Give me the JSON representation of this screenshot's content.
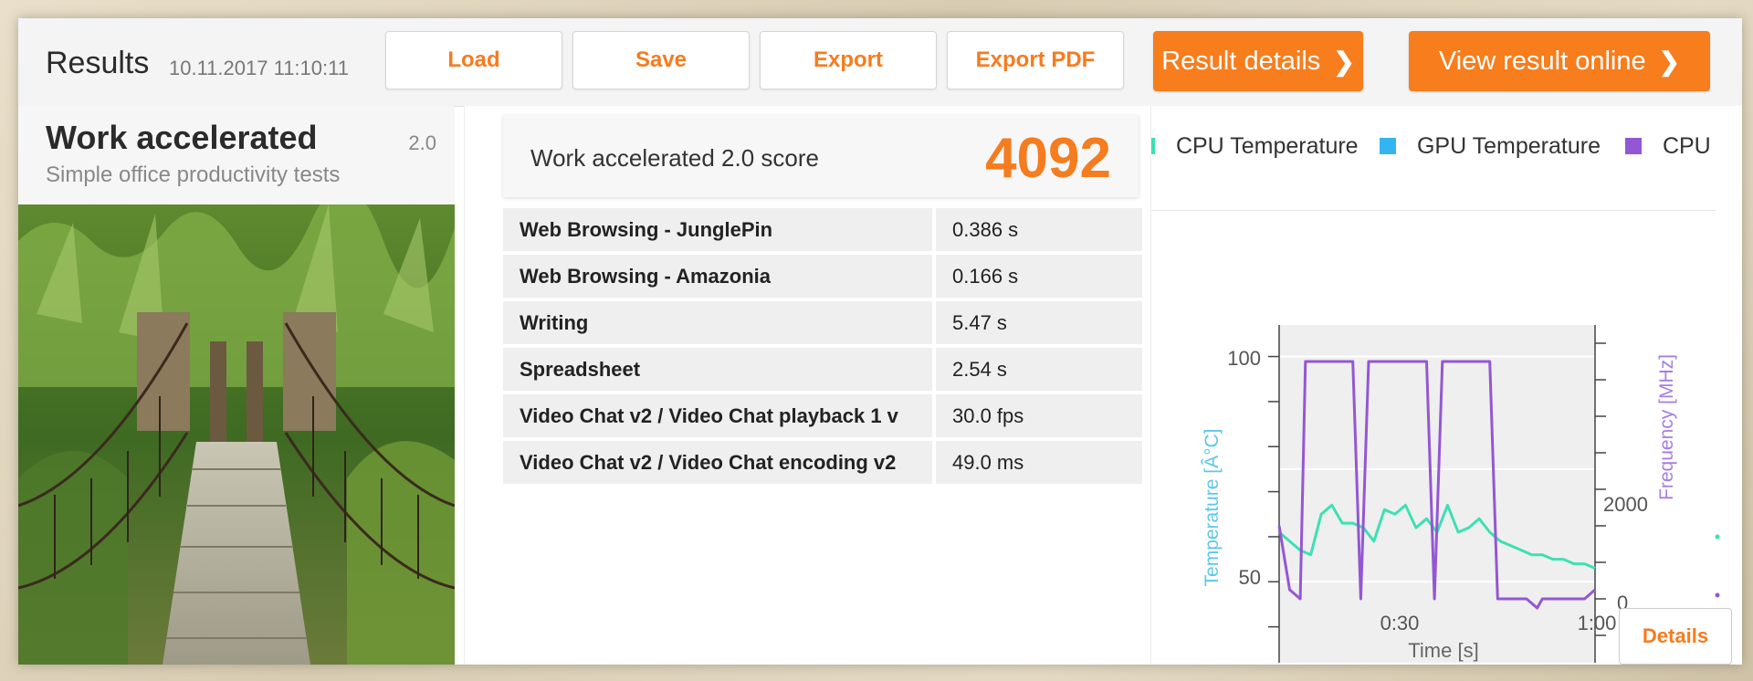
{
  "header": {
    "title": "Results",
    "date": "10.11.2017 11:10:11",
    "buttons": {
      "load": "Load",
      "save": "Save",
      "export": "Export",
      "export_pdf": "Export PDF"
    },
    "result_details": "Result details",
    "view_online": "View result online",
    "chevron": "❯"
  },
  "test": {
    "name": "Work accelerated",
    "version": "2.0",
    "description": "Simple office productivity tests",
    "image": "rope-bridge-jungle-photo"
  },
  "score": {
    "label": "Work accelerated 2.0 score",
    "value": "4092"
  },
  "subtests": [
    {
      "name": "Web Browsing - JunglePin",
      "value": "0.386 s"
    },
    {
      "name": "Web Browsing - Amazonia",
      "value": "0.166 s"
    },
    {
      "name": "Writing",
      "value": "5.47 s"
    },
    {
      "name": "Spreadsheet",
      "value": "2.54 s"
    },
    {
      "name": "Video Chat v2 / Video Chat playback 1 v",
      "value": "30.0 fps"
    },
    {
      "name": "Video Chat v2 / Video Chat encoding v2",
      "value": "49.0 ms"
    }
  ],
  "monitoring": {
    "legend": [
      {
        "name": "CPU Temperature",
        "color": "#3de0b4"
      },
      {
        "name": "GPU Temperature",
        "color": "#33b5f0"
      },
      {
        "name": "CPU Cl",
        "color": "#9457d3"
      }
    ],
    "details_label": "Details"
  },
  "chart_data": {
    "type": "line",
    "title": "",
    "xlabel": "Time [s]",
    "ylabel_left": "Temperature [Â°C]",
    "ylabel_right": "Frequency [MHz]",
    "x_ticks": [
      "0:30",
      "1:00"
    ],
    "y_left_ticks": [
      "100",
      "50"
    ],
    "y_right_ticks": [
      "2000",
      "0"
    ],
    "xlim": [
      0,
      60
    ],
    "ylim_left": [
      30,
      107
    ],
    "ylim_right": [
      0,
      3800
    ],
    "grid": true,
    "series": [
      {
        "name": "CPU Temperature",
        "axis": "left",
        "color": "#3de0b4",
        "x": [
          0,
          2,
          4,
          6,
          8,
          10,
          12,
          14,
          16,
          18,
          20,
          22,
          24,
          26,
          28,
          30,
          32,
          34,
          36,
          38,
          40,
          42,
          44,
          46,
          48,
          50,
          52,
          54,
          56,
          58,
          60
        ],
        "values": [
          61,
          59,
          57,
          56,
          65,
          67,
          63,
          63,
          62,
          59,
          66,
          65,
          67,
          62,
          64,
          61,
          67,
          61,
          62,
          64,
          61,
          59,
          58,
          57,
          56,
          56,
          55,
          55,
          54,
          54,
          53
        ]
      },
      {
        "name": "CPU Cl",
        "axis": "right",
        "color": "#9457d3",
        "x": [
          0,
          2,
          4,
          5,
          6.5,
          14,
          15.5,
          17,
          18.5,
          28,
          29.5,
          31,
          32.5,
          40,
          41.5,
          42,
          47,
          48,
          49,
          50,
          52,
          58,
          60
        ],
        "values": [
          1600,
          900,
          800,
          3400,
          3400,
          3400,
          800,
          3400,
          3400,
          3400,
          800,
          3400,
          3400,
          3400,
          800,
          800,
          800,
          750,
          700,
          800,
          800,
          800,
          900
        ]
      }
    ]
  }
}
